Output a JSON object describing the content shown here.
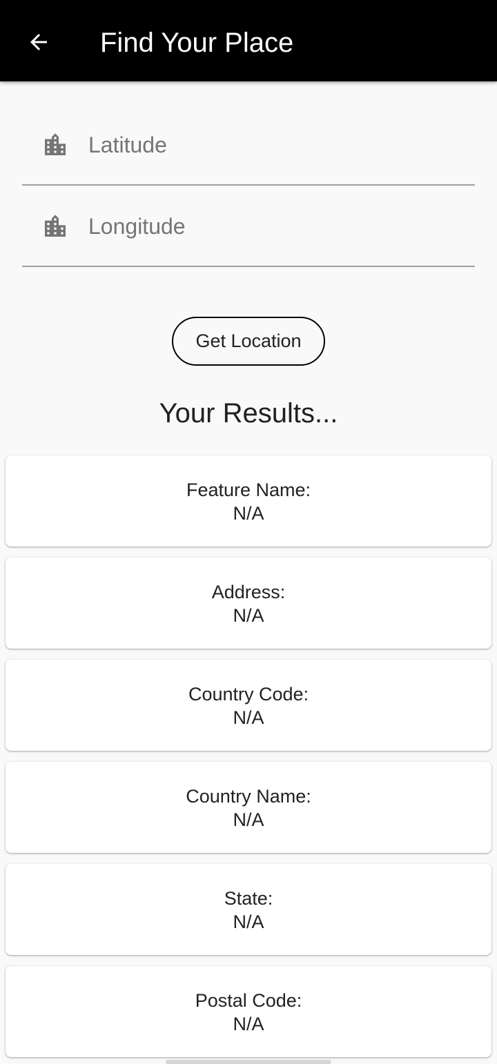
{
  "appbar": {
    "title": "Find Your Place",
    "back_icon": "arrow-left-icon"
  },
  "form": {
    "latitude": {
      "placeholder": "Latitude",
      "value": "",
      "icon": "city-icon"
    },
    "longitude": {
      "placeholder": "Longitude",
      "value": "",
      "icon": "city-icon"
    },
    "button_label": "Get Location"
  },
  "results": {
    "title": "Your Results...",
    "items": [
      {
        "label": "Feature Name:",
        "value": "N/A"
      },
      {
        "label": "Address:",
        "value": "N/A"
      },
      {
        "label": "Country Code:",
        "value": "N/A"
      },
      {
        "label": "Country Name:",
        "value": "N/A"
      },
      {
        "label": "State:",
        "value": "N/A"
      },
      {
        "label": "Postal Code:",
        "value": "N/A"
      }
    ]
  },
  "colors": {
    "appbar_bg": "#000000",
    "page_bg": "#f9f9f9",
    "card_bg": "#ffffff",
    "icon": "#757575"
  }
}
